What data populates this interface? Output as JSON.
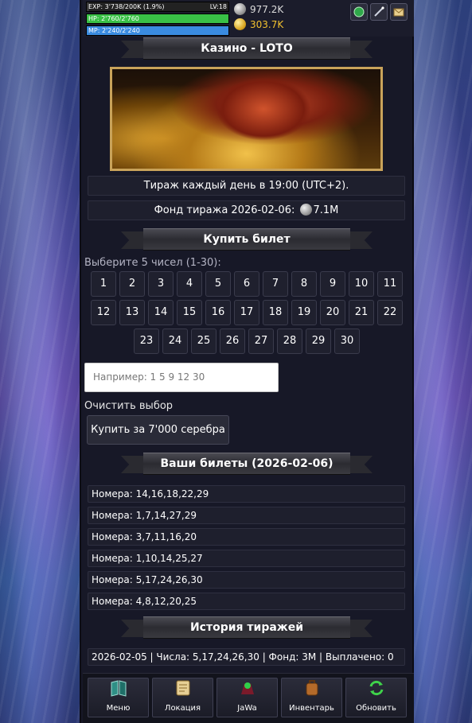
{
  "status": {
    "exp_text": "EXP: 3'738/200K (1.9%)",
    "exp_fraction": 0.019,
    "level_text": "LV:18",
    "hp_text": "HP: 2'760/2'760",
    "hp_fraction": 1.0,
    "mp_text": "MP: 2'240/2'240",
    "mp_fraction": 1.0,
    "silver": "977.2K",
    "gold": "303.7K",
    "icons": [
      "green-orb-icon",
      "wand-icon",
      "mail-icon"
    ]
  },
  "casino": {
    "title": "Казино - LOTO",
    "draw_time": "Тираж каждый день в 19:00 (UTC+2).",
    "fund_prefix": "Фонд тиража 2026-02-06:",
    "fund_value": "7.1M"
  },
  "buy": {
    "title": "Купить билет",
    "choose_label": "Выберите 5 чисел (1-30):",
    "numbers": [
      [
        "1",
        "2",
        "3",
        "4",
        "5",
        "6",
        "7",
        "8",
        "9",
        "10",
        "11"
      ],
      [
        "12",
        "13",
        "14",
        "15",
        "16",
        "17",
        "18",
        "19",
        "20",
        "21",
        "22"
      ],
      [
        "23",
        "24",
        "25",
        "26",
        "27",
        "28",
        "29",
        "30"
      ]
    ],
    "input_placeholder": "Например: 1 5 9 12 30",
    "clear_label": "Очистить выбор",
    "buy_label": "Купить за 7'000 серебра"
  },
  "tickets": {
    "title": "Ваши билеты (2026-02-06)",
    "items": [
      "Номера: 14,16,18,22,29",
      "Номера: 1,7,14,27,29",
      "Номера: 3,7,11,16,20",
      "Номера: 1,10,14,25,27",
      "Номера: 5,17,24,26,30",
      "Номера: 4,8,12,20,25"
    ]
  },
  "history": {
    "title": "История тиражей",
    "items": [
      "2026-02-05 | Числа: 5,17,24,26,30 | Фонд: 3M | Выплачено: 0"
    ]
  },
  "menu": [
    {
      "label": "Меню",
      "icon": "book-icon"
    },
    {
      "label": "Локация",
      "icon": "scroll-map-icon"
    },
    {
      "label": "JaWa",
      "icon": "character-icon"
    },
    {
      "label": "Инвентарь",
      "icon": "backpack-icon"
    },
    {
      "label": "Обновить",
      "icon": "refresh-icon"
    }
  ]
}
